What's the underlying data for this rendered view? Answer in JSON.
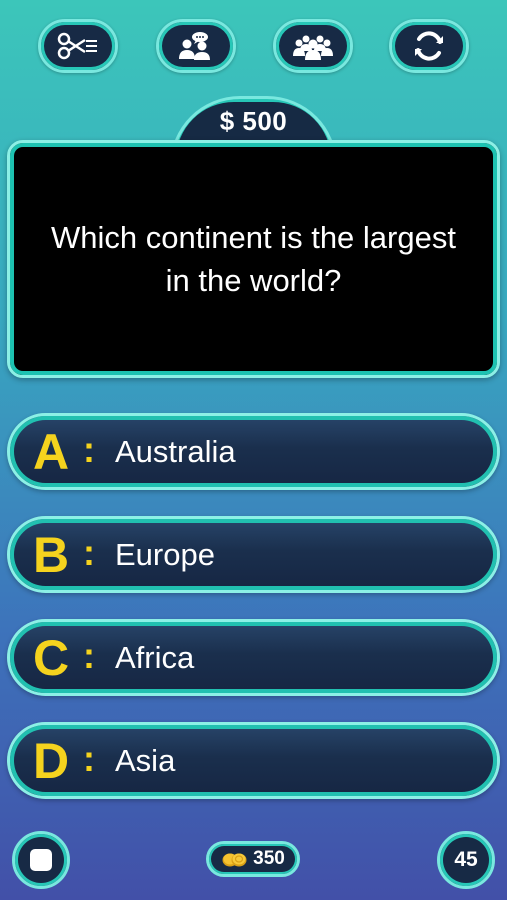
{
  "lifelines": [
    {
      "icon": "scissors-icon"
    },
    {
      "icon": "phone-friend-icon"
    },
    {
      "icon": "audience-icon"
    },
    {
      "icon": "swap-question-icon"
    }
  ],
  "prize": "$ 500",
  "question": "Which continent is the largest in the world?",
  "answers": [
    {
      "letter": "A",
      "text": "Australia"
    },
    {
      "letter": "B",
      "text": "Europe"
    },
    {
      "letter": "C",
      "text": "Africa"
    },
    {
      "letter": "D",
      "text": "Asia"
    }
  ],
  "answer_colon": ":",
  "coins": "350",
  "timer": "45",
  "colors": {
    "accent_yellow": "#f5d31e",
    "border_teal": "#79e8df",
    "panel_navy": "#172a45",
    "question_bg": "#000000"
  }
}
